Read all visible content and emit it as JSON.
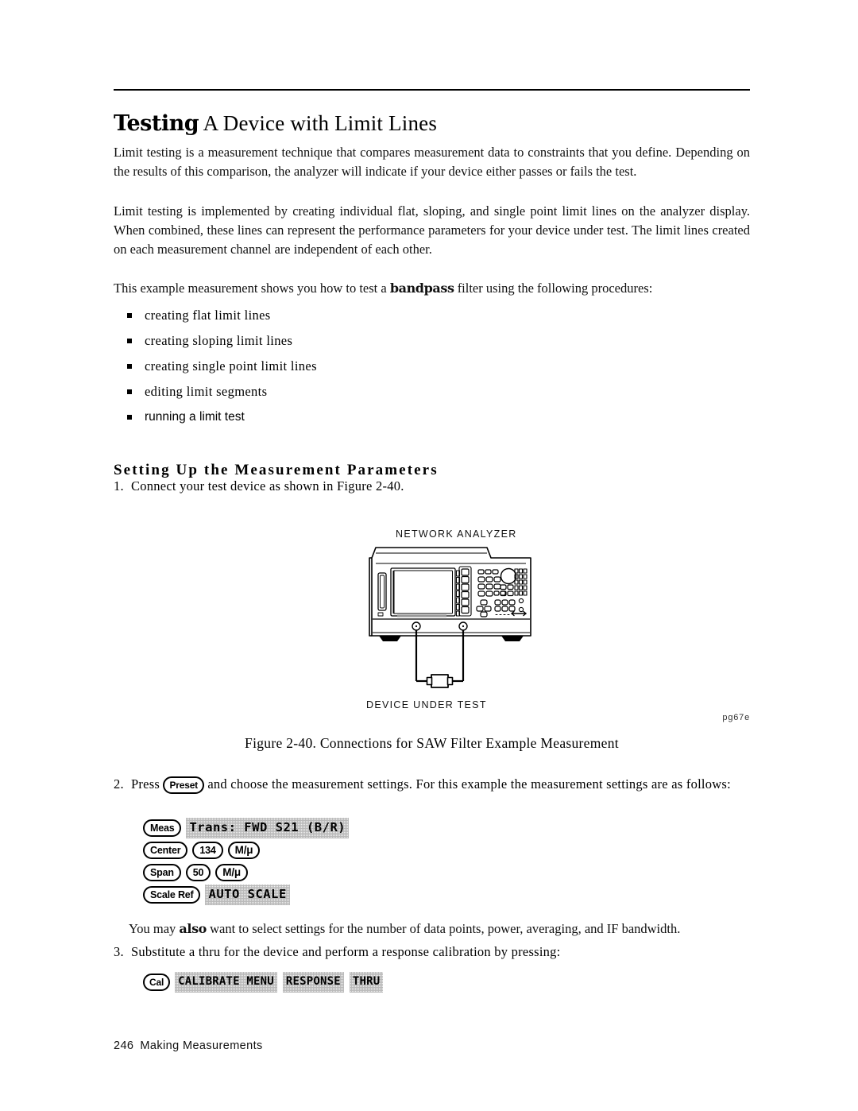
{
  "page": {
    "title_bold": "Testing",
    "title_rest": " A Device with Limit Lines",
    "footer_page": "246",
    "footer_section": "Making Measurements"
  },
  "paragraphs": {
    "p1": "Limit testing is a measurement technique that compares measurement data to constraints that you define. Depending on the results of this comparison, the analyzer will indicate if your device either passes or fails the test.",
    "p2": "Limit testing is implemented by creating individual flat, sloping, and single point limit lines on the analyzer display. When combined, these lines can represent the performance parameters for your device under test. The limit lines created on each measurement channel are independent of each other.",
    "p3_before": "This example measurement shows you how to test a ",
    "p3_bold": "bandpass",
    "p3_after": " filter using the following procedures:",
    "p4_before": "You may ",
    "p4_bold": "also",
    "p4_after": " want to select settings for the number of data points, power, averaging, and IF bandwidth."
  },
  "bullets": [
    "creating flat limit lines",
    "creating sloping limit lines",
    "creating single point limit lines",
    "editing limit segments",
    "running a limit test"
  ],
  "section": {
    "heading": "Setting Up the Measurement Parameters"
  },
  "steps": {
    "s1_num": "1.",
    "s1_text": "Connect your test device as shown in Figure 2-40.",
    "s2_num": "2.",
    "s2_before": "Press ",
    "s2_key": "Preset",
    "s2_after": " and choose the measurement settings. For this example the measurement settings are as follows:",
    "s3_num": "3.",
    "s3_text": "Substitute a thru for the device and perform a response calibration by pressing:"
  },
  "figure": {
    "label_analyzer": "NETWORK  ANALYZER",
    "label_dut": "DEVICE  UNDER  TEST",
    "label_artwork_id": "pg67e",
    "caption": "Figure 2-40. Connections for SAW Filter Example Measurement"
  },
  "key_sequences": {
    "setup": [
      {
        "keys": [
          {
            "type": "hard",
            "label": "Meas"
          }
        ],
        "softkeys": [
          "Trans: FWD S21 (B/R)"
        ]
      },
      {
        "keys": [
          {
            "type": "hard",
            "label": "Center"
          },
          {
            "type": "hard",
            "label": "134"
          },
          {
            "type": "hard",
            "label": "M/μ"
          }
        ],
        "softkeys": []
      },
      {
        "keys": [
          {
            "type": "hard",
            "label": "Span"
          },
          {
            "type": "hard",
            "label": "50"
          },
          {
            "type": "hard",
            "label": "M/μ"
          }
        ],
        "softkeys": []
      },
      {
        "keys": [
          {
            "type": "hard",
            "label": "Scale Ref"
          }
        ],
        "softkeys": [
          "AUTO SCALE"
        ]
      }
    ],
    "calibration": [
      {
        "keys": [
          {
            "type": "hard",
            "label": "Cal"
          }
        ],
        "softkeys": [
          "CALIBRATE MENU",
          "RESPONSE",
          "THRU"
        ]
      }
    ]
  },
  "colors": {
    "ink": "#000000",
    "paper": "#ffffff",
    "softkey_fill": "#efefef"
  }
}
